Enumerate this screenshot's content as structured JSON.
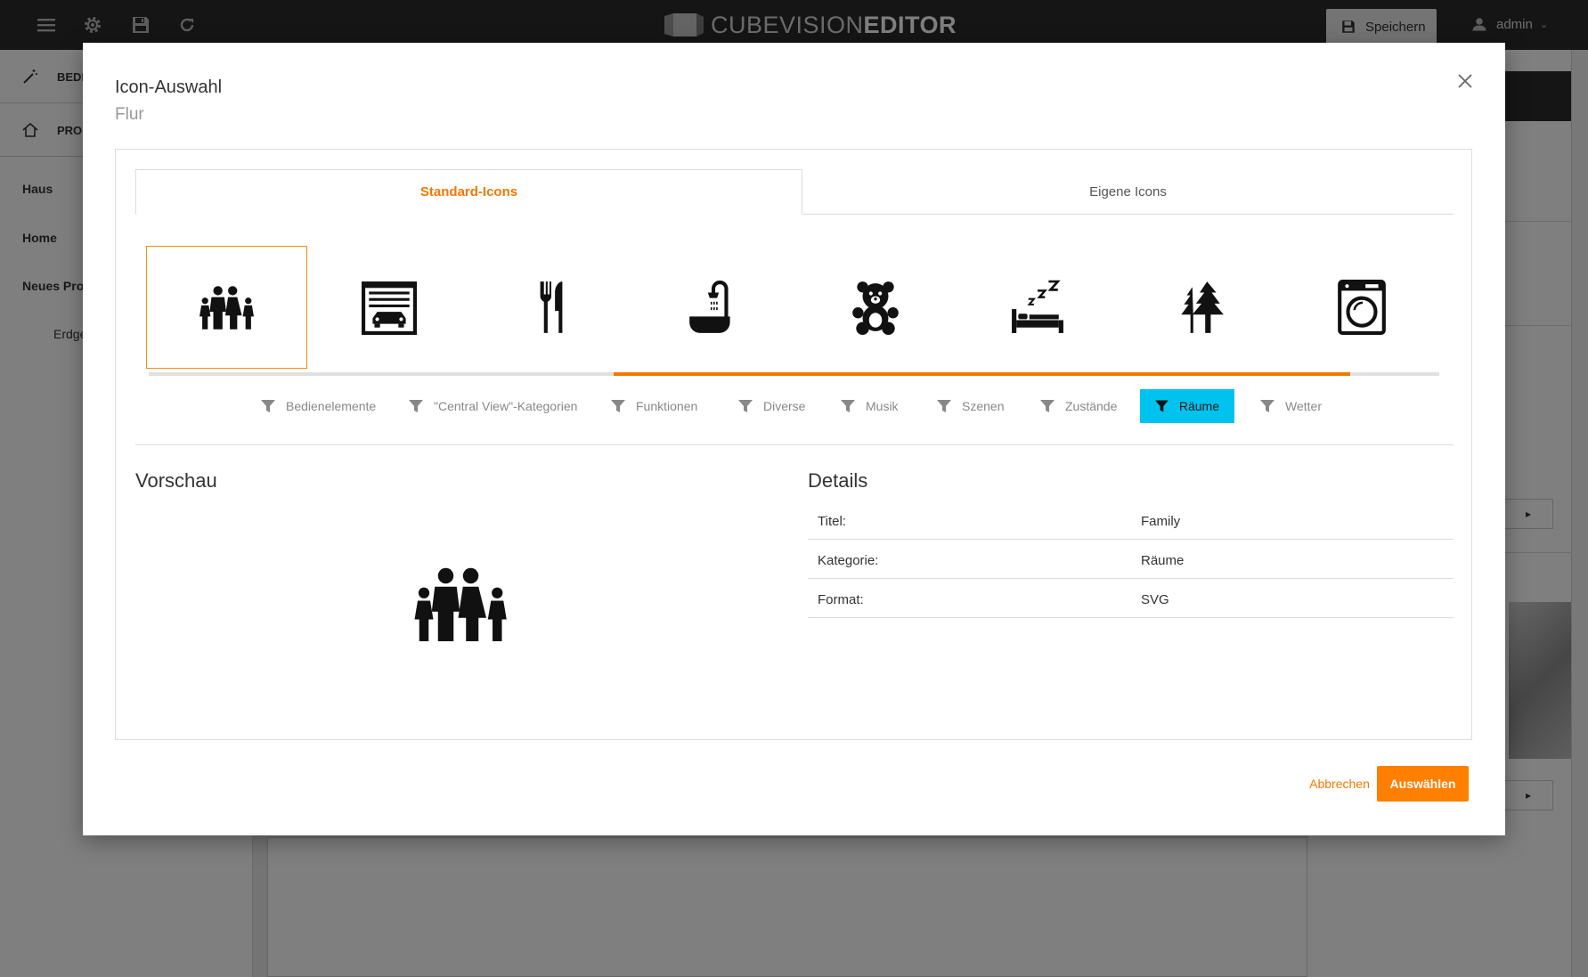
{
  "app": {
    "brand_light": "CUBEVISION",
    "brand_bold": "EDITOR",
    "save_label": "Speichern",
    "user_label": "admin"
  },
  "sidebar": {
    "top_items": [
      {
        "label": "BEDI",
        "icon": "magic-wand-icon"
      },
      {
        "label": "PRO.",
        "icon": "home-icon"
      }
    ],
    "links": [
      "Haus",
      "Home",
      "Neues Proj",
      "Erdge"
    ]
  },
  "modal": {
    "title": "Icon-Auswahl",
    "subtitle": "Flur",
    "tabs": [
      {
        "label": "Standard-Icons",
        "active": true
      },
      {
        "label": "Eigene Icons",
        "active": false
      }
    ],
    "icons": [
      {
        "name": "family-icon",
        "selected": true
      },
      {
        "name": "garage-icon",
        "selected": false
      },
      {
        "name": "fork-knife-icon",
        "selected": false
      },
      {
        "name": "bathtub-shower-icon",
        "selected": false
      },
      {
        "name": "teddy-bear-icon",
        "selected": false
      },
      {
        "name": "bed-sleep-icon",
        "selected": false
      },
      {
        "name": "trees-icon",
        "selected": false
      },
      {
        "name": "washing-machine-icon",
        "selected": false
      }
    ],
    "filters": [
      {
        "label": "Bedienelemente",
        "active": false
      },
      {
        "label": "\"Central View\"-Kategorien",
        "active": false
      },
      {
        "label": "Funktionen",
        "active": false
      },
      {
        "label": "Diverse",
        "active": false
      },
      {
        "label": "Musik",
        "active": false
      },
      {
        "label": "Szenen",
        "active": false
      },
      {
        "label": "Zustände",
        "active": false
      },
      {
        "label": "Räume",
        "active": true
      },
      {
        "label": "Wetter",
        "active": false
      }
    ],
    "preview_title": "Vorschau",
    "details_title": "Details",
    "details": [
      {
        "key": "Titel:",
        "value": "Family"
      },
      {
        "key": "Kategorie:",
        "value": "Räume"
      },
      {
        "key": "Format:",
        "value": "SVG"
      }
    ],
    "cancel_label": "Abbrechen",
    "confirm_label": "Auswählen"
  },
  "colors": {
    "accent": "#f07800",
    "filter_active": "#00c2ee",
    "topbar": "#2b2b2b"
  }
}
